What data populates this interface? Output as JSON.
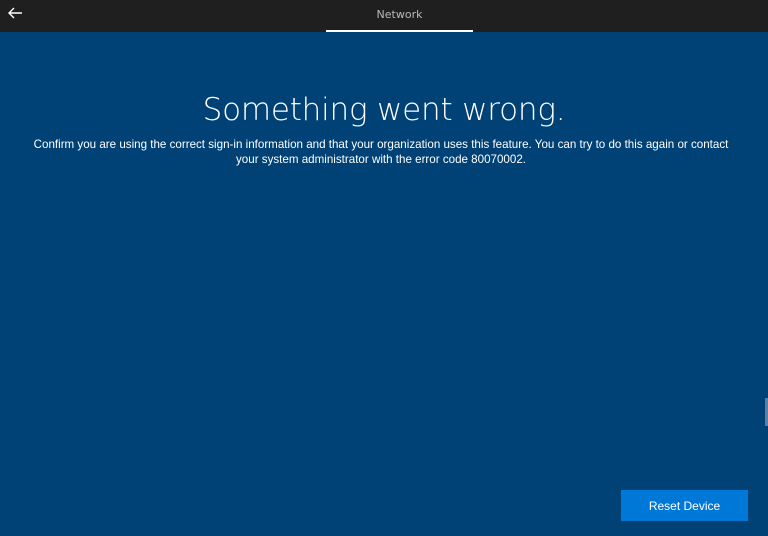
{
  "topbar": {
    "back_icon": "arrow-left-icon",
    "tab_label": "Network"
  },
  "main": {
    "title": "Something went wrong.",
    "message": "Confirm you are using the correct sign-in information and that your organization uses this feature. You can try to do this again or contact your system administrator with the error code 80070002."
  },
  "actions": {
    "reset_label": "Reset Device"
  },
  "colors": {
    "background": "#004275",
    "topbar": "#1f1f1f",
    "button": "#0078d7",
    "text": "#ffffff"
  }
}
